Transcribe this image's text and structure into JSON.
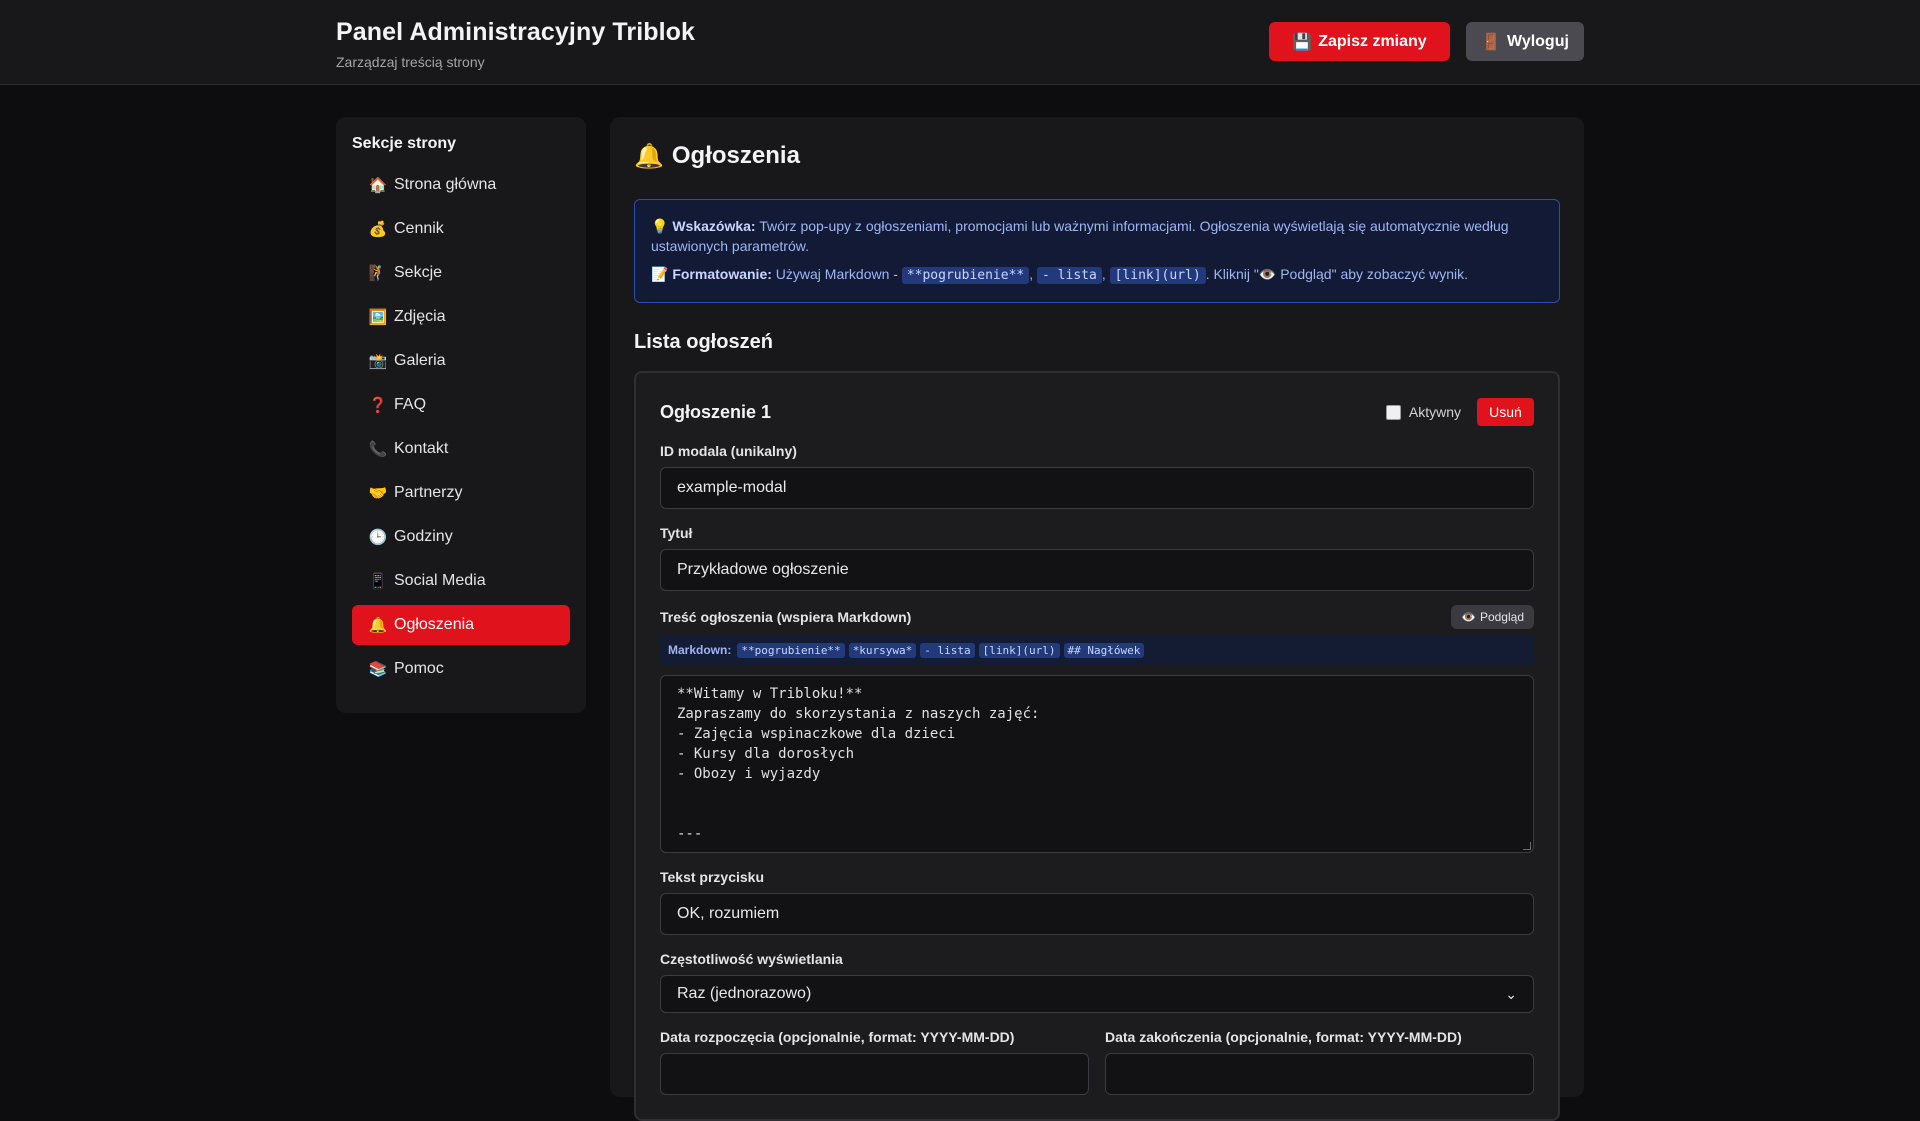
{
  "header": {
    "title": "Panel Administracyjny Triblok",
    "subtitle": "Zarządzaj treścią strony",
    "save_icon": "💾",
    "save_label": "Zapisz zmiany",
    "logout_icon": "🚪",
    "logout_label": "Wyloguj"
  },
  "sidebar": {
    "title": "Sekcje strony",
    "items": [
      {
        "icon": "🏠",
        "label": "Strona główna"
      },
      {
        "icon": "💰",
        "label": "Cennik"
      },
      {
        "icon": "🧗",
        "label": "Sekcje"
      },
      {
        "icon": "🖼️",
        "label": "Zdjęcia"
      },
      {
        "icon": "📸",
        "label": "Galeria"
      },
      {
        "icon": "❓",
        "label": "FAQ"
      },
      {
        "icon": "📞",
        "label": "Kontakt"
      },
      {
        "icon": "🤝",
        "label": "Partnerzy"
      },
      {
        "icon": "🕒",
        "label": "Godziny"
      },
      {
        "icon": "📱",
        "label": "Social Media"
      },
      {
        "icon": "🔔",
        "label": "Ogłoszenia"
      },
      {
        "icon": "📚",
        "label": "Pomoc"
      }
    ],
    "active_index": 10
  },
  "main": {
    "title_icon": "🔔",
    "title": "Ogłoszenia",
    "tip": {
      "icon1": "💡",
      "label1": "Wskazówka:",
      "text1": " Twórz pop-upy z ogłoszeniami, promocjami lub ważnymi informacjami. Ogłoszenia wyświetlają się automatycznie według ustawionych parametrów.",
      "icon2": "📝",
      "label2": "Formatowanie:",
      "text2a": " Używaj Markdown - ",
      "code1": "**pogrubienie**",
      "sep1": ", ",
      "code2": "- lista",
      "sep2": ", ",
      "code3": "[link](url)",
      "text2b": ". Kliknij \"👁️ Podgląd\" aby zobaczyć wynik."
    },
    "list_title": "Lista ogłoszeń",
    "card": {
      "title": "Ogłoszenie 1",
      "active_label": "Aktywny",
      "active_checked": false,
      "delete_label": "Usuń",
      "id_label": "ID modala (unikalny)",
      "id_value": "example-modal",
      "title_label": "Tytuł",
      "title_value": "Przykładowe ogłoszenie",
      "content_label": "Treść ogłoszenia (wspiera Markdown)",
      "preview_icon": "👁️",
      "preview_label": "Podgląd",
      "md_label": "Markdown:",
      "md_codes": [
        "**pogrubienie**",
        "*kursywa*",
        "- lista",
        "[link](url)",
        "## Nagłówek"
      ],
      "content_value": "**Witamy w Tribloku!**\nZapraszamy do skorzystania z naszych zajęć:\n- Zajęcia wspinaczkowe dla dzieci\n- Kursy dla dorosłych\n- Obozy i wyjazdy\n\n\n---",
      "button_text_label": "Tekst przycisku",
      "button_text_value": "OK, rozumiem",
      "frequency_label": "Częstotliwość wyświetlania",
      "frequency_value": "Raz (jednorazowo)",
      "start_label": "Data rozpoczęcia (opcjonalnie, format: YYYY-MM-DD)",
      "end_label": "Data zakończenia (opcjonalnie, format: YYYY-MM-DD)"
    }
  },
  "colors": {
    "accent": "#e0121c",
    "background": "#0d0d0f",
    "panel": "#18181b",
    "tip_border": "#2c4ea8"
  }
}
